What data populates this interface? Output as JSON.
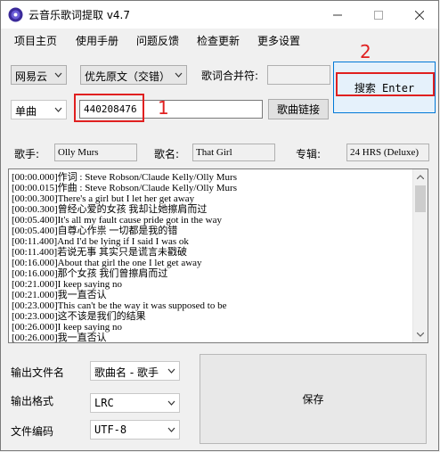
{
  "window": {
    "title": "云音乐歌词提取 v4.7"
  },
  "menu": [
    "项目主页",
    "使用手册",
    "问题反馈",
    "检查更新",
    "更多设置"
  ],
  "source_combo": "网易云",
  "mode_combo": "优先原文（交错）",
  "merge_label": "歌词合并符:",
  "merge_value": "",
  "search_button": "搜索 Enter",
  "type_combo": "单曲",
  "song_id": "440208476",
  "song_link_button": "歌曲链接",
  "annotation_1": "1",
  "annotation_2": "2",
  "singer_label": "歌手:",
  "singer_value": "Olly Murs",
  "song_label": "歌名:",
  "song_value": "That Girl",
  "album_label": "专辑:",
  "album_value": "24 HRS (Deluxe)",
  "lyrics": [
    "[00:00.000]作词 : Steve Robson/Claude Kelly/Olly Murs",
    "[00:00.015]作曲 : Steve Robson/Claude Kelly/Olly Murs",
    "[00:00.300]There's a girl but I let her get away",
    "[00:00.300]曾经心爱的女孩 我却让她擦肩而过",
    "[00:05.400]It's all my fault cause pride got in the way",
    "[00:05.400]自尊心作祟 一切都是我的错",
    "[00:11.400]And I'd be lying if I said I was ok",
    "[00:11.400]若说无事 其实只是谎言未戳破",
    "[00:16.000]About that girl the one I let get away",
    "[00:16.000]那个女孩 我们曾擦肩而过",
    "[00:21.000]I keep saying no",
    "[00:21.000]我一直否认",
    "[00:23.000]This can't be the way it was supposed to be",
    "[00:23.000]这不该是我们的结果",
    "[00:26.000]I keep saying no",
    "[00:26.000]我一直否认"
  ],
  "output_name_label": "输出文件名",
  "output_name_value": "歌曲名 - 歌手",
  "output_format_label": "输出格式",
  "output_format_value": "LRC",
  "encoding_label": "文件编码",
  "encoding_value": "UTF-8",
  "save_button": "保存"
}
